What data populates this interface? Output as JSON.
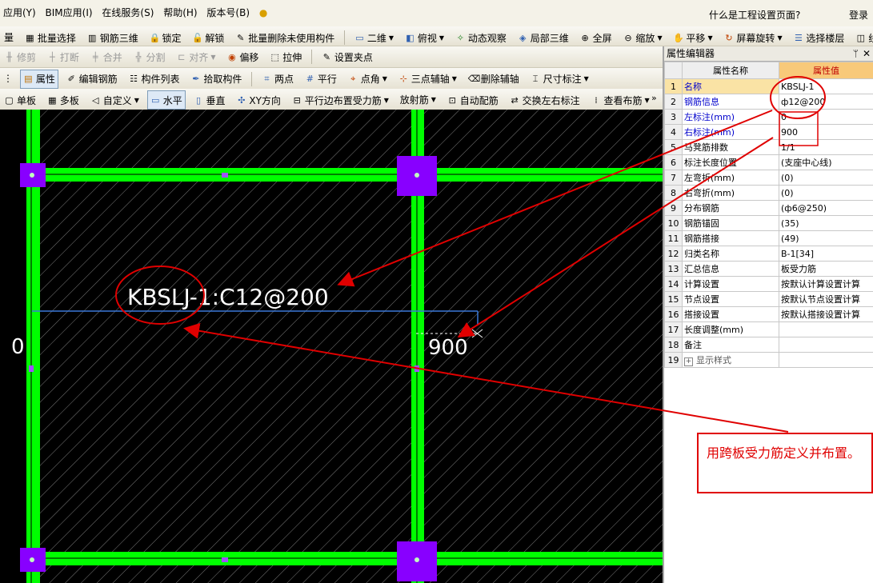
{
  "menu": {
    "items": [
      "应用(Y)",
      "BIM应用(I)",
      "在线服务(S)",
      "帮助(H)",
      "版本号(B)"
    ],
    "ask": "什么是工程设置页面?",
    "login": "登录"
  },
  "toolbar1": [
    "量",
    "批量选择",
    "钢筋三维",
    "锁定",
    "解锁",
    "批量删除未使用构件",
    "二维",
    "俯视",
    "动态观察",
    "局部三维",
    "全屏",
    "缩放",
    "平移",
    "屏幕旋转",
    "选择楼层",
    "线框"
  ],
  "toolbar2": [
    "修剪",
    "打断",
    "合并",
    "分割",
    "对齐",
    "偏移",
    "拉伸",
    "设置夹点"
  ],
  "toolbar3": [
    "属性",
    "编辑钢筋",
    "构件列表",
    "拾取构件",
    "两点",
    "平行",
    "点角",
    "三点辅轴",
    "删除辅轴",
    "尺寸标注"
  ],
  "toolbar4": [
    "单板",
    "多板",
    "自定义",
    "水平",
    "垂直",
    "XY方向",
    "平行边布置受力筋",
    "放射筋",
    "自动配筋",
    "交换左右标注",
    "查看布筋"
  ],
  "panel": {
    "title": "属性编辑器",
    "col_name": "属性名称",
    "col_value": "属性值",
    "rows": [
      {
        "num": "1",
        "name": "名称",
        "value": "KBSLJ-1"
      },
      {
        "num": "2",
        "name": "钢筋信息",
        "value": "ф12@200"
      },
      {
        "num": "3",
        "name": "左标注(mm)",
        "value": "0"
      },
      {
        "num": "4",
        "name": "右标注(mm)",
        "value": "900"
      },
      {
        "num": "5",
        "name": "马凳筋排数",
        "value": "1/1"
      },
      {
        "num": "6",
        "name": "标注长度位置",
        "value": "(支座中心线)"
      },
      {
        "num": "7",
        "name": "左弯折(mm)",
        "value": "(0)"
      },
      {
        "num": "8",
        "name": "右弯折(mm)",
        "value": "(0)"
      },
      {
        "num": "9",
        "name": "分布钢筋",
        "value": "(ф6@250)"
      },
      {
        "num": "10",
        "name": "钢筋锚固",
        "value": "(35)"
      },
      {
        "num": "11",
        "name": "钢筋搭接",
        "value": "(49)"
      },
      {
        "num": "12",
        "name": "归类名称",
        "value": "B-1[34]"
      },
      {
        "num": "13",
        "name": "汇总信息",
        "value": "板受力筋"
      },
      {
        "num": "14",
        "name": "计算设置",
        "value": "按默认计算设置计算"
      },
      {
        "num": "15",
        "name": "节点设置",
        "value": "按默认节点设置计算"
      },
      {
        "num": "16",
        "name": "搭接设置",
        "value": "按默认搭接设置计算"
      },
      {
        "num": "17",
        "name": "长度调整(mm)",
        "value": ""
      },
      {
        "num": "18",
        "name": "备注",
        "value": ""
      },
      {
        "num": "19",
        "name": "显示样式",
        "value": ""
      }
    ]
  },
  "canvas": {
    "rebar_label": "KBSLJ-1:C12@200",
    "left_mark": "0",
    "right_mark": "900"
  },
  "note": "用跨板受力筋定义并布置。",
  "colors": {
    "beam": "#00ff00",
    "column": "#8800ff",
    "annotation": "#e00000",
    "rebar": "#3a78d8"
  }
}
